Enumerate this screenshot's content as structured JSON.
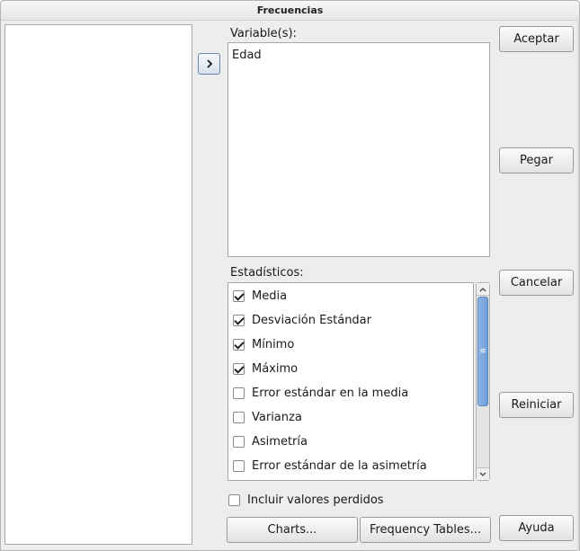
{
  "window": {
    "title": "Frecuencias"
  },
  "move_button": {
    "icon": "chevron-right-icon"
  },
  "variables": {
    "label": "Variable(s):",
    "items": [
      "Edad"
    ]
  },
  "statistics": {
    "label": "Estadísticos:",
    "items": [
      {
        "label": "Media",
        "checked": true
      },
      {
        "label": "Desviación Estándar",
        "checked": true
      },
      {
        "label": "Mínimo",
        "checked": true
      },
      {
        "label": "Máximo",
        "checked": true
      },
      {
        "label": "Error estándar en la media",
        "checked": false
      },
      {
        "label": "Varianza",
        "checked": false
      },
      {
        "label": "Asimetría",
        "checked": false
      },
      {
        "label": "Error estándar de la asimetría",
        "checked": false
      }
    ]
  },
  "include_missing": {
    "label": "Incluir valores perdidos",
    "checked": false
  },
  "buttons": {
    "accept": "Aceptar",
    "paste": "Pegar",
    "cancel": "Cancelar",
    "reset": "Reiniciar",
    "help": "Ayuda",
    "charts": "Charts...",
    "frequency_tables": "Frequency Tables..."
  },
  "colors": {
    "scroll_thumb": "#7aa7dd",
    "arrow_button_border": "#6d87a8"
  }
}
